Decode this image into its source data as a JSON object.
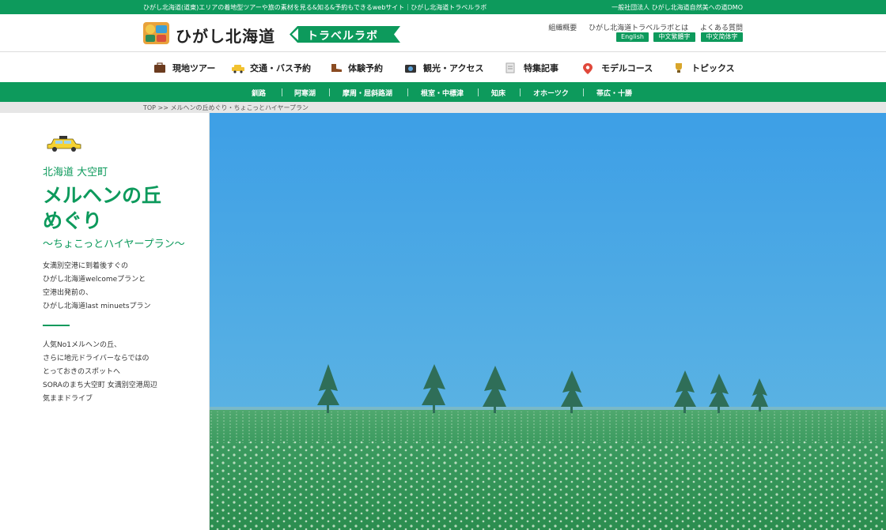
{
  "topbar": {
    "tagline": "ひがし北海道(道東)エリアの着地型ツアーや旅の素材を見る&知る&予約もできるwebサイト｜ひがし北海道トラベルラボ",
    "org": "一般社団法人 ひがし北海道自然美への道DMO"
  },
  "header": {
    "logo_title": "ひがし北海道",
    "logo_badge": "トラベルラボ",
    "links": [
      "組織概要",
      "ひがし北海道トラベルラボとは",
      "よくある質問"
    ],
    "languages": [
      "English",
      "中文繁體字",
      "中文简体字"
    ]
  },
  "nav": [
    {
      "label": "現地ツアー",
      "icon": "suitcase-icon"
    },
    {
      "label": "交通・バス予約",
      "icon": "taxi-icon"
    },
    {
      "label": "体験予約",
      "icon": "boot-icon"
    },
    {
      "label": "観光・アクセス",
      "icon": "camera-icon"
    },
    {
      "label": "特集記事",
      "icon": "document-icon"
    },
    {
      "label": "モデルコース",
      "icon": "map-pin-icon"
    },
    {
      "label": "トピックス",
      "icon": "trophy-icon"
    }
  ],
  "areas": [
    "釧路",
    "阿寒湖",
    "摩周・屈斜路湖",
    "根室・中標津",
    "知床",
    "オホーツク",
    "帯広・十勝"
  ],
  "breadcrumb": "TOP >> メルヘンの丘めぐり・ちょこっとハイヤープラン",
  "plan": {
    "place": "北海道 大空町",
    "title_line1": "メルヘンの丘",
    "title_line2": "めぐり",
    "subtitle": "〜ちょこっとハイヤープラン〜",
    "desc1": [
      "女満別空港に到着後すぐの",
      "ひがし北海道welcomeプランと",
      "空港出発前の、",
      "ひがし北海道last minuetsプラン"
    ],
    "desc2": [
      "人気No1メルヘンの丘、",
      "さらに地元ドライバーならではの",
      "とっておきのスポットへ",
      "SORAのまち大空町 女満別空港周辺",
      "気ままドライブ"
    ]
  },
  "colors": {
    "brand": "#0d9a5c",
    "sky": "#3fa3e3",
    "field": "#2f9a5a"
  }
}
